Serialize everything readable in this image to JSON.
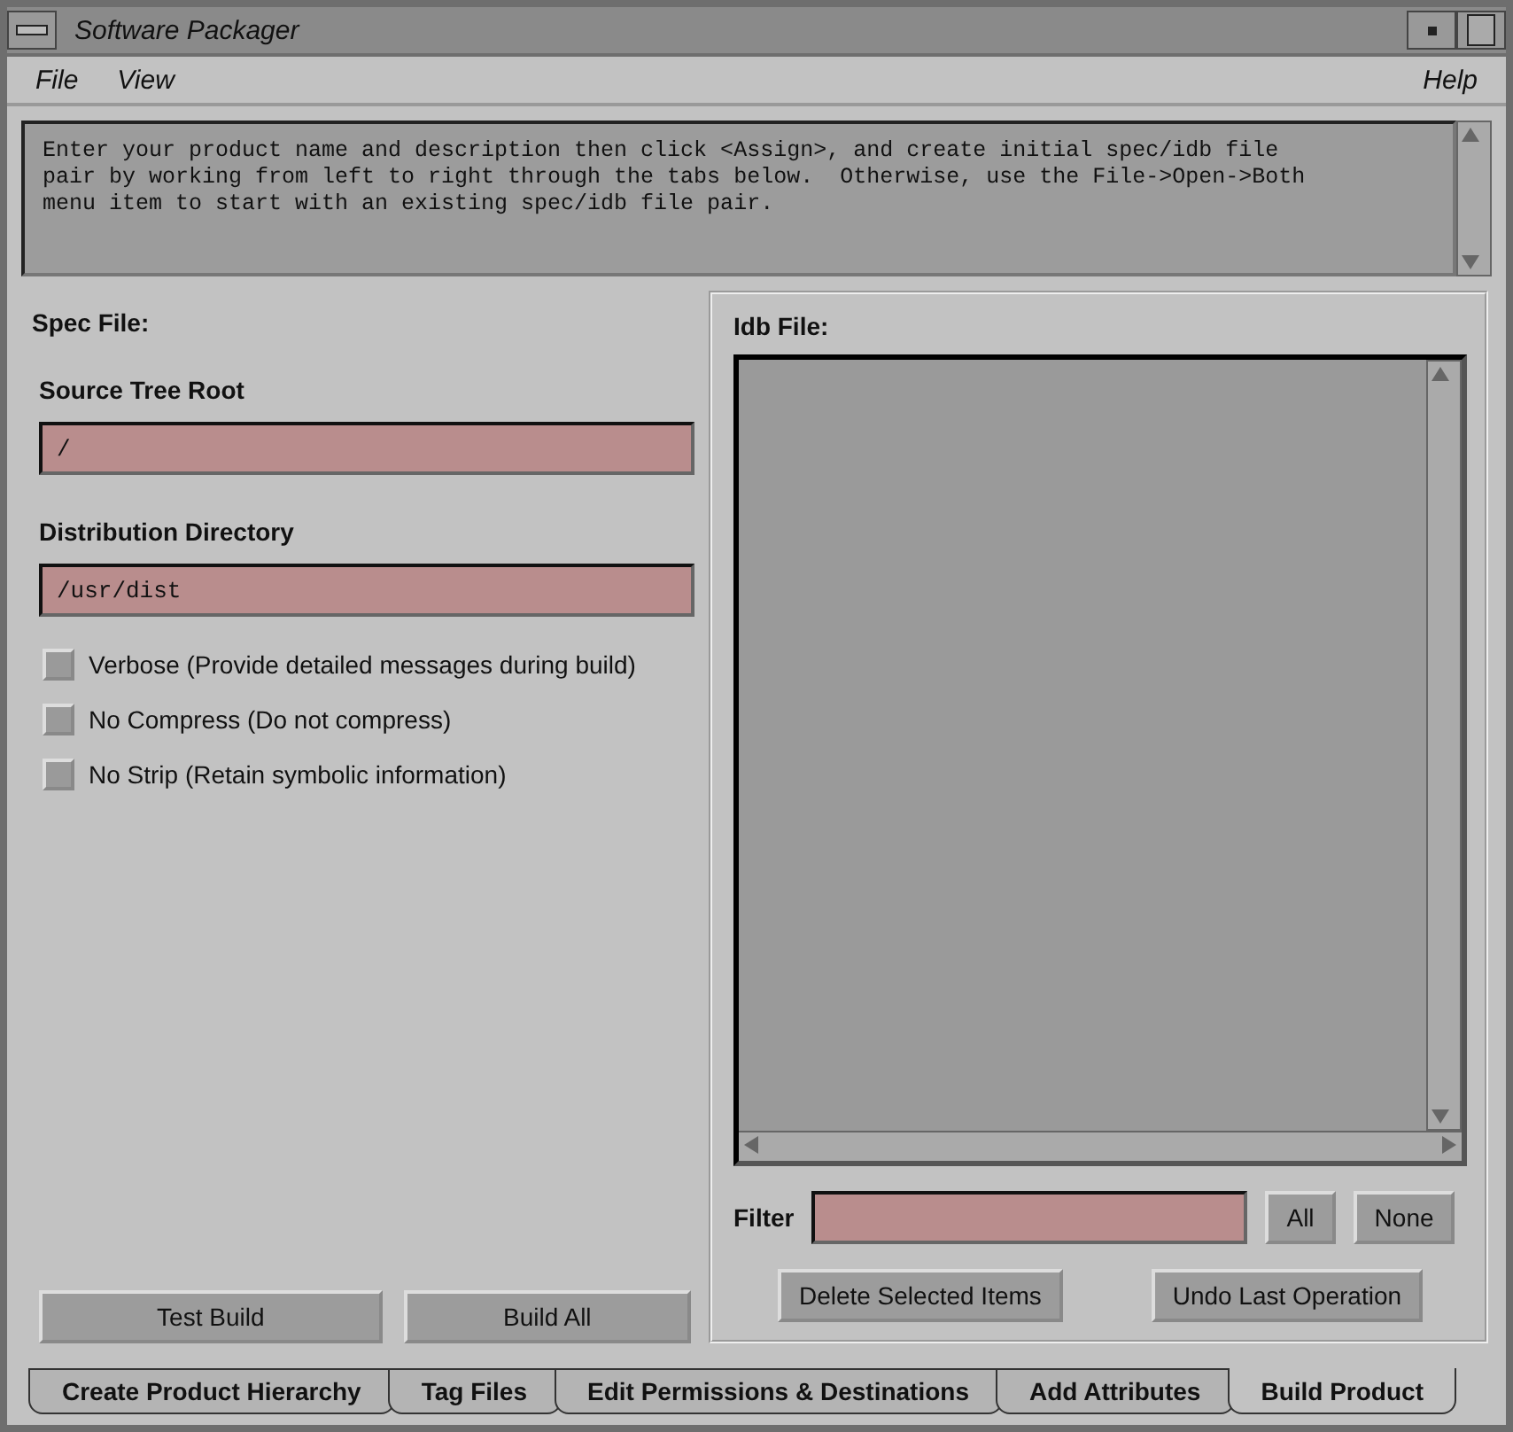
{
  "window": {
    "title": "Software Packager"
  },
  "menu": [
    {
      "label": "File"
    },
    {
      "label": "View"
    },
    {
      "label": "Help"
    }
  ],
  "message": "Enter your product name and description then click <Assign>, and create initial spec/idb file\npair by working from left to right through the tabs below.  Otherwise, use the File->Open->Both\nmenu item to start with an existing spec/idb file pair.",
  "spec": {
    "title": "Spec File:",
    "fields": [
      {
        "label": "Source Tree Root",
        "value": "/"
      },
      {
        "label": "Distribution Directory",
        "value": "/usr/dist"
      }
    ],
    "options": [
      {
        "label": "Verbose (Provide detailed messages during build)",
        "checked": false
      },
      {
        "label": "No Compress (Do not compress)",
        "checked": false
      },
      {
        "label": "No Strip (Retain symbolic information)",
        "checked": false
      }
    ],
    "buttons": [
      "Test Build",
      "Build All"
    ]
  },
  "idb": {
    "title": "Idb File:",
    "filter_label": "Filter",
    "filter_buttons": [
      "All",
      "None"
    ],
    "buttons": [
      "Delete Selected Items",
      "Undo Last Operation"
    ]
  },
  "tabs": [
    {
      "label": "Create Product Hierarchy",
      "selected": false
    },
    {
      "label": "Tag Files",
      "selected": false
    },
    {
      "label": "Edit Permissions & Destinations",
      "selected": false
    },
    {
      "label": "Add Attributes",
      "selected": false
    },
    {
      "label": "Build Product",
      "selected": true
    }
  ]
}
